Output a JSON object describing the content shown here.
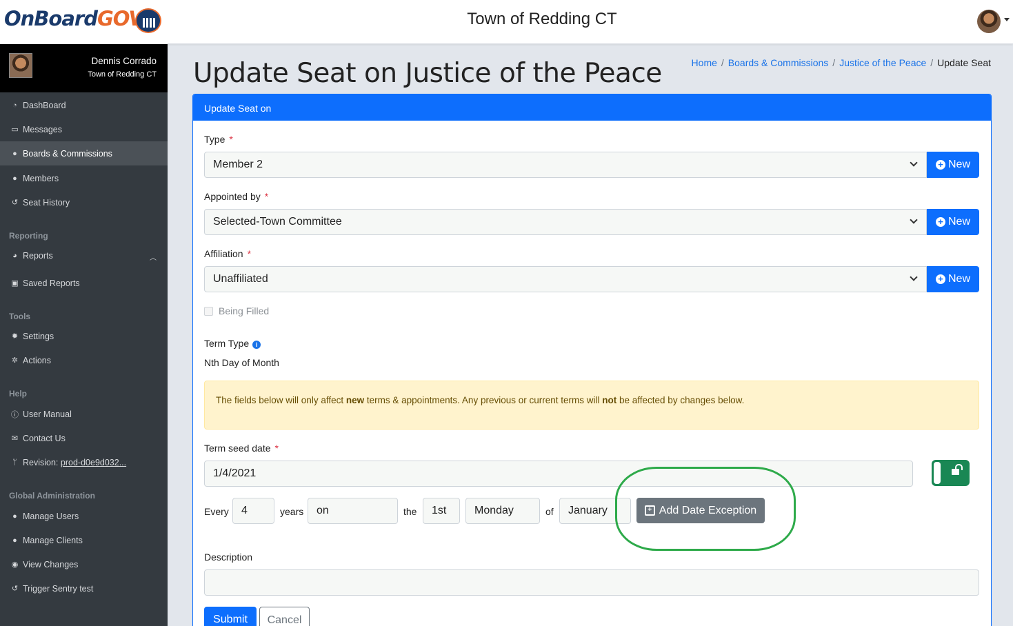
{
  "header": {
    "logo_on": "On",
    "logo_board": "Board",
    "logo_gov": "GOV",
    "site_title": "Town of Redding CT"
  },
  "user": {
    "name": "Dennis Corrado",
    "org": "Town of Redding CT"
  },
  "sidebar": {
    "main": [
      {
        "label": "DashBoard",
        "icon": "dashboard-icon"
      },
      {
        "label": "Messages",
        "icon": "inbox-icon"
      },
      {
        "label": "Boards & Commissions",
        "icon": "users-icon"
      },
      {
        "label": "Members",
        "icon": "user-icon"
      },
      {
        "label": "Seat History",
        "icon": "history-icon"
      }
    ],
    "reporting_header": "Reporting",
    "reporting": [
      {
        "label": "Reports",
        "icon": "pie-chart-icon"
      },
      {
        "label": "Saved Reports",
        "icon": "save-icon"
      }
    ],
    "tools_header": "Tools",
    "tools": [
      {
        "label": "Settings",
        "icon": "gear-icon"
      },
      {
        "label": "Actions",
        "icon": "gears-icon"
      }
    ],
    "help_header": "Help",
    "help": [
      {
        "label": "User Manual",
        "icon": "info-icon"
      },
      {
        "label": "Contact Us",
        "icon": "envelope-icon"
      },
      {
        "label": "Revision:",
        "value": "prod-d0e9d032...",
        "icon": "branch-icon"
      }
    ],
    "admin_header": "Global Administration",
    "admin": [
      {
        "label": "Manage Users",
        "icon": "user-icon"
      },
      {
        "label": "Manage Clients",
        "icon": "users-icon"
      },
      {
        "label": "View Changes",
        "icon": "eye-icon"
      },
      {
        "label": "Trigger Sentry test",
        "icon": "history-icon"
      }
    ]
  },
  "page": {
    "title": "Update Seat on Justice of the Peace",
    "breadcrumb": [
      "Home",
      "Boards & Commissions",
      "Justice of the Peace",
      "Update Seat"
    ],
    "sep": "/"
  },
  "form": {
    "card_title": "Update Seat on",
    "type_label": "Type",
    "type_value": "Member 2",
    "appointed_label": "Appointed by",
    "appointed_value": "Selected-Town Committee",
    "affiliation_label": "Affiliation",
    "affiliation_value": "Unaffiliated",
    "new_label": "New",
    "req_mark": "*",
    "being_filled_label": "Being Filled",
    "term_type_label": "Term Type",
    "term_type_value": "Nth Day of Month",
    "alert_pre": "The fields below will only affect ",
    "alert_new": "new",
    "alert_mid": " terms & appointments. Any previous or current terms will ",
    "alert_not": "not",
    "alert_post": " be affected by changes below.",
    "seed_label": "Term seed date",
    "seed_value": "1/4/2021",
    "every_label": "Every",
    "every_value": "4",
    "years_label": "years",
    "on_value": "on",
    "the_label": "the",
    "nth_value": "1st",
    "weekday_value": "Monday",
    "of_label": "of",
    "month_value": "January",
    "add_exception_label": "Add Date Exception",
    "description_label": "Description",
    "description_value": "",
    "submit_label": "Submit",
    "cancel_label": "Cancel"
  },
  "colors": {
    "primary": "#0d6efd",
    "sidebar_bg": "#343a40",
    "success": "#198754",
    "highlight": "#2eaa4a",
    "alert_bg": "#fff3cd"
  }
}
